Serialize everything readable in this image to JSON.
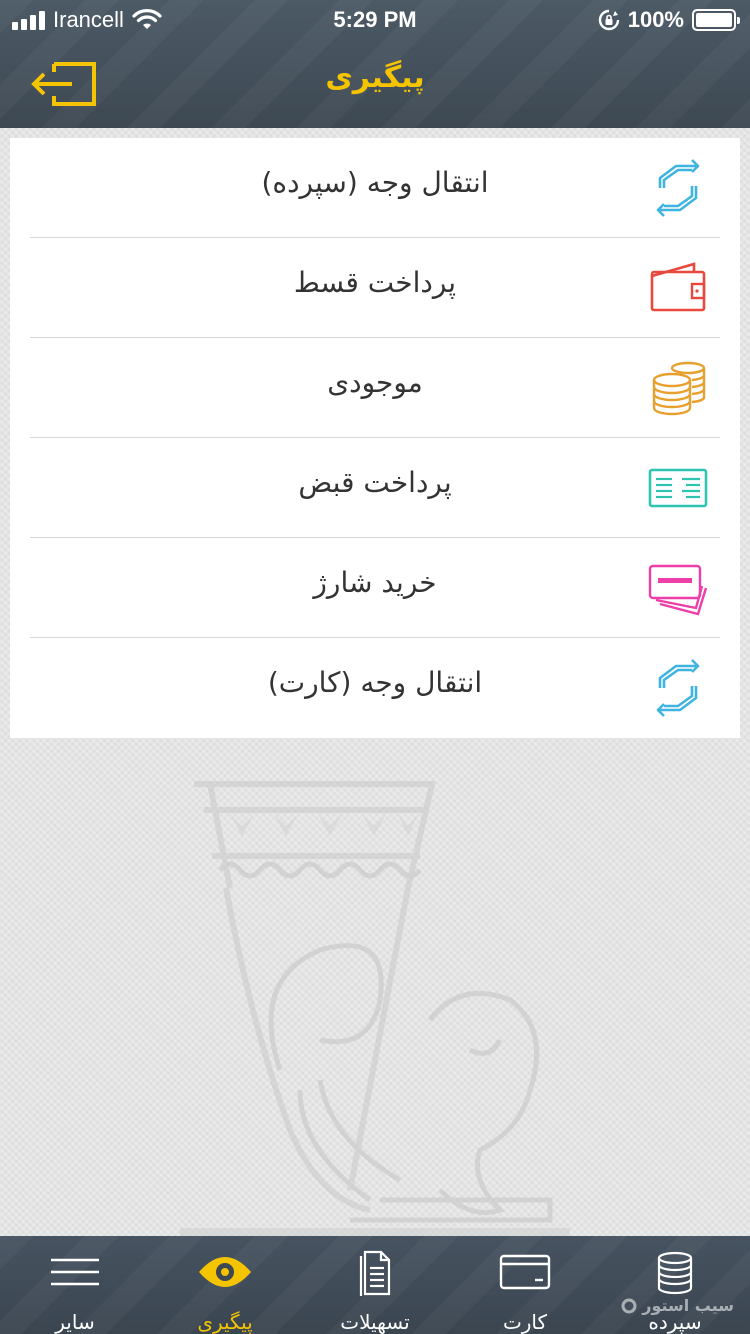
{
  "status_bar": {
    "carrier": "Irancell",
    "time": "5:29 PM",
    "battery": "100%"
  },
  "header": {
    "title": "پیگیری",
    "back_icon": "exit-arrow-icon",
    "accent_color": "#f5c400"
  },
  "menu": {
    "items": [
      {
        "label": "انتقال وجه (سپرده)",
        "icon": "transfer-arrows-icon",
        "color": "#3fb4e0"
      },
      {
        "label": "پرداخت قسط",
        "icon": "wallet-icon",
        "color": "#e8493d"
      },
      {
        "label": "موجودی",
        "icon": "coins-icon",
        "color": "#e8a02c"
      },
      {
        "label": "پرداخت قبض",
        "icon": "bill-icon",
        "color": "#2ec4b0"
      },
      {
        "label": "خرید شارژ",
        "icon": "charge-cards-icon",
        "color": "#ee3fa8"
      },
      {
        "label": "انتقال وجه (کارت)",
        "icon": "transfer-arrows-icon",
        "color": "#3fb4e0"
      }
    ]
  },
  "tab_bar": {
    "tabs": [
      {
        "label": "سایر",
        "icon": "menu-lines-icon",
        "active": false
      },
      {
        "label": "پیگیری",
        "icon": "eye-icon",
        "active": true
      },
      {
        "label": "تسهیلات",
        "icon": "document-icon",
        "active": false
      },
      {
        "label": "کارت",
        "icon": "card-icon",
        "active": false
      },
      {
        "label": "سپرده",
        "icon": "coins-icon",
        "active": false
      }
    ]
  },
  "watermark_text": "سیب استور"
}
